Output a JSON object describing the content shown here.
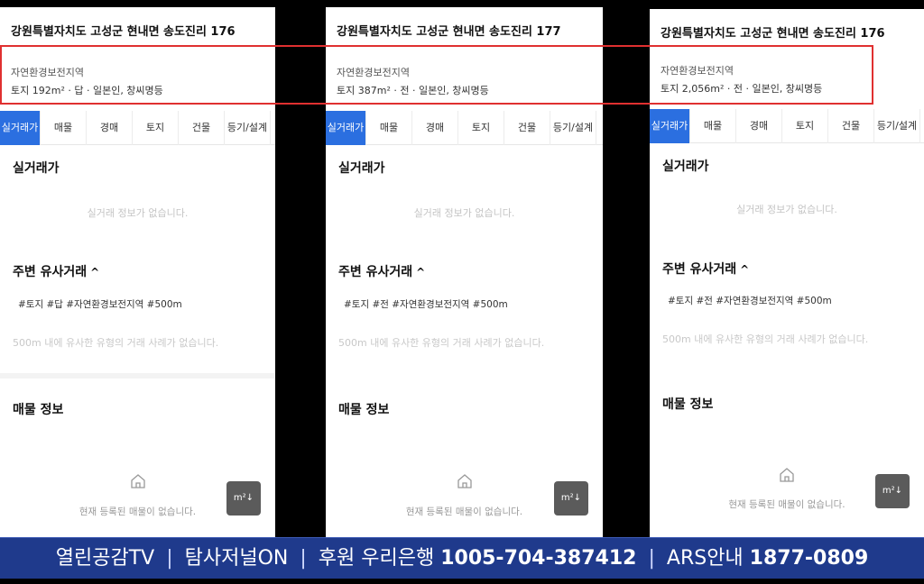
{
  "panels": [
    {
      "address": "강원특별자치도 고성군 현내면 송도진리 176",
      "zone": "자연환경보전지역",
      "land_info": "토지 192m² · 답 · 일본인, 창씨명등",
      "tabs": [
        "실거래가",
        "매물",
        "경매",
        "토지",
        "건물",
        "등기/설계"
      ],
      "active_tab": "실거래가",
      "section_sil": "실거래가",
      "sil_empty": "실거래 정보가 없습니다.",
      "section_near": "주변 유사거래",
      "near_chevron": "^",
      "hashtags": "#토지 #답 #자연환경보전지역 #500m",
      "near_empty": "500m 내에 유사한 유형의 거래 사례가 없습니다.",
      "section_listing": "매물 정보",
      "listing_empty": "현재 등록된 매물이 없습니다.",
      "unit_button": "m²↓"
    },
    {
      "address": "강원특별자치도 고성군 현내면 송도진리 177",
      "zone": "자연환경보전지역",
      "land_info": "토지 387m² · 전 · 일본인, 창씨명등",
      "tabs": [
        "실거래가",
        "매물",
        "경매",
        "토지",
        "건물",
        "등기/설계"
      ],
      "active_tab": "실거래가",
      "section_sil": "실거래가",
      "sil_empty": "실거래 정보가 없습니다.",
      "section_near": "주변 유사거래",
      "near_chevron": "^",
      "hashtags": "#토지 #전 #자연환경보전지역 #500m",
      "near_empty": "500m 내에 유사한 유형의 거래 사례가 없습니다.",
      "section_listing": "매물 정보",
      "listing_empty": "현재 등록된 매물이 없습니다.",
      "unit_button": "m²↓"
    },
    {
      "address": "강원특별자치도 고성군 현내면 송도진리 176",
      "zone": "자연환경보전지역",
      "land_info": "토지 2,056m² · 전 · 일본인, 창씨명등",
      "tabs": [
        "실거래가",
        "매물",
        "경매",
        "토지",
        "건물",
        "등기/설계"
      ],
      "active_tab": "실거래가",
      "section_sil": "실거래가",
      "sil_empty": "실거래 정보가 없습니다.",
      "section_near": "주변 유사거래",
      "near_chevron": "^",
      "hashtags": "#토지 #전 #자연환경보전지역 #500m",
      "near_empty": "500m 내에 유사한 유형의 거래 사례가 없습니다.",
      "section_listing": "매물 정보",
      "listing_empty": "현재 등록된 매물이 없습니다.",
      "unit_button": "m²↓"
    }
  ],
  "ticker": {
    "channel": "열린공감TV",
    "partner": "탐사저널ON",
    "donation_label": "후원 우리은행",
    "donation_account": "1005-704-387412",
    "ars_label": "ARS안내",
    "ars_number": "1877-0809",
    "separator": "|"
  },
  "colors": {
    "active_tab": "#2b6fe0",
    "highlight_box": "#e03030",
    "ticker_bg": "#1f3a8c"
  }
}
